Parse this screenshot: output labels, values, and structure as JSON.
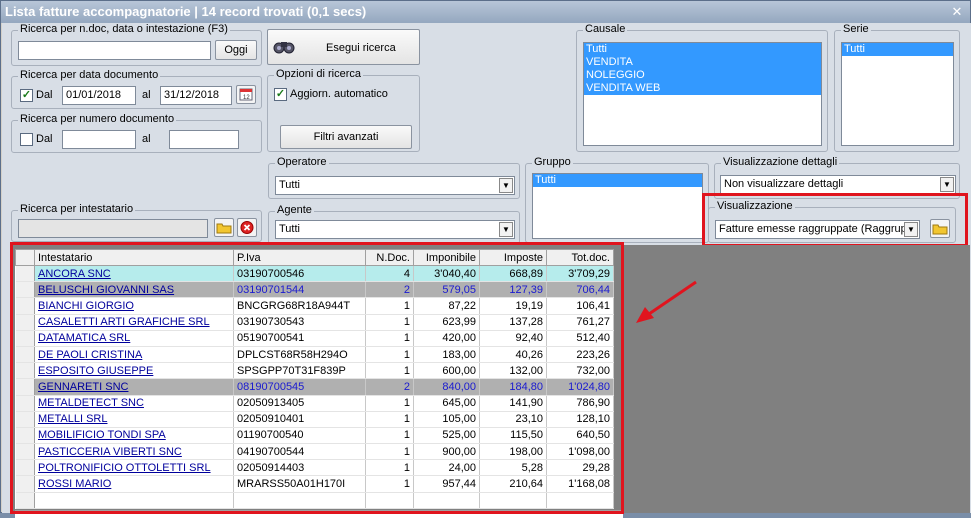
{
  "window": {
    "title": "Lista fatture accompagnatorie | 14 record trovati (0,1 secs)",
    "close_glyph": "✕"
  },
  "search_doc": {
    "legend": "Ricerca per n.doc, data o intestazione (F3)",
    "value": "",
    "today_label": "Oggi"
  },
  "search_button": {
    "label": "Esegui ricerca"
  },
  "date_search": {
    "legend": "Ricerca per data documento",
    "from_label": "Dal",
    "from_checked": true,
    "from_value": "01/01/2018",
    "to_label": "al",
    "to_value": "31/12/2018"
  },
  "number_search": {
    "legend": "Ricerca per numero documento",
    "from_label": "Dal",
    "from_checked": false,
    "from_value": "",
    "to_label": "al",
    "to_value": ""
  },
  "options": {
    "legend": "Opzioni di ricerca",
    "auto_update_label": "Aggiorn. automatico",
    "auto_update_checked": true,
    "advanced_filters_label": "Filtri avanzati"
  },
  "causale": {
    "legend": "Causale",
    "items": [
      "Tutti",
      "VENDITA",
      "NOLEGGIO",
      "VENDITA WEB"
    ]
  },
  "serie": {
    "legend": "Serie",
    "items": [
      "Tutti"
    ]
  },
  "operatore": {
    "legend": "Operatore",
    "value": "Tutti"
  },
  "agente": {
    "legend": "Agente",
    "value": "Tutti"
  },
  "gruppo": {
    "legend": "Gruppo",
    "items": [
      "Tutti"
    ]
  },
  "vis_dettagli": {
    "legend": "Visualizzazione dettagli",
    "value": "Non visualizzare dettagli"
  },
  "visualizzazione": {
    "legend": "Visualizzazione",
    "value": "Fatture emesse raggruppate (Raggrup"
  },
  "intestatario": {
    "legend": "Ricerca per intestatario",
    "value": ""
  },
  "grid": {
    "columns": [
      "Intestatario",
      "P.Iva",
      "N.Doc.",
      "Imponibile",
      "Imposte",
      "Tot.doc."
    ],
    "rows": [
      {
        "name": "ANCORA SNC",
        "piva": "03190700546",
        "ndoc": "4",
        "imponibile": "3'040,40",
        "imposte": "668,89",
        "tot": "3'709,29",
        "style": "hl"
      },
      {
        "name": "BELUSCHI GIOVANNI SAS",
        "piva": "03190701544",
        "ndoc": "2",
        "imponibile": "579,05",
        "imposte": "127,39",
        "tot": "706,44",
        "style": "gr"
      },
      {
        "name": "BIANCHI GIORGIO",
        "piva": "BNCGRG68R18A944T",
        "ndoc": "1",
        "imponibile": "87,22",
        "imposte": "19,19",
        "tot": "106,41",
        "style": ""
      },
      {
        "name": "CASALETTI ARTI GRAFICHE SRL",
        "piva": "03190730543",
        "ndoc": "1",
        "imponibile": "623,99",
        "imposte": "137,28",
        "tot": "761,27",
        "style": ""
      },
      {
        "name": "DATAMATICA SRL",
        "piva": "05190700541",
        "ndoc": "1",
        "imponibile": "420,00",
        "imposte": "92,40",
        "tot": "512,40",
        "style": ""
      },
      {
        "name": "DE PAOLI CRISTINA",
        "piva": "DPLCST68R58H294O",
        "ndoc": "1",
        "imponibile": "183,00",
        "imposte": "40,26",
        "tot": "223,26",
        "style": ""
      },
      {
        "name": "ESPOSITO GIUSEPPE",
        "piva": "SPSGPP70T31F839P",
        "ndoc": "1",
        "imponibile": "600,00",
        "imposte": "132,00",
        "tot": "732,00",
        "style": ""
      },
      {
        "name": "GENNARETI SNC",
        "piva": "08190700545",
        "ndoc": "2",
        "imponibile": "840,00",
        "imposte": "184,80",
        "tot": "1'024,80",
        "style": "gr"
      },
      {
        "name": "METALDETECT SNC",
        "piva": "02050913405",
        "ndoc": "1",
        "imponibile": "645,00",
        "imposte": "141,90",
        "tot": "786,90",
        "style": ""
      },
      {
        "name": "METALLI SRL",
        "piva": "02050910401",
        "ndoc": "1",
        "imponibile": "105,00",
        "imposte": "23,10",
        "tot": "128,10",
        "style": ""
      },
      {
        "name": "MOBILIFICIO TONDI SPA",
        "piva": "01190700540",
        "ndoc": "1",
        "imponibile": "525,00",
        "imposte": "115,50",
        "tot": "640,50",
        "style": ""
      },
      {
        "name": "PASTICCERIA VIBERTI SNC",
        "piva": "04190700544",
        "ndoc": "1",
        "imponibile": "900,00",
        "imposte": "198,00",
        "tot": "1'098,00",
        "style": ""
      },
      {
        "name": "POLTRONIFICIO OTTOLETTI SRL",
        "piva": "02050914403",
        "ndoc": "1",
        "imponibile": "24,00",
        "imposte": "5,28",
        "tot": "29,28",
        "style": ""
      },
      {
        "name": "ROSSI MARIO",
        "piva": "MRARSS50A01H170I",
        "ndoc": "1",
        "imponibile": "957,44",
        "imposte": "210,64",
        "tot": "1'168,08",
        "style": ""
      }
    ]
  },
  "colors": {
    "highlight": "#e0141e",
    "selection": "#3399ff"
  }
}
